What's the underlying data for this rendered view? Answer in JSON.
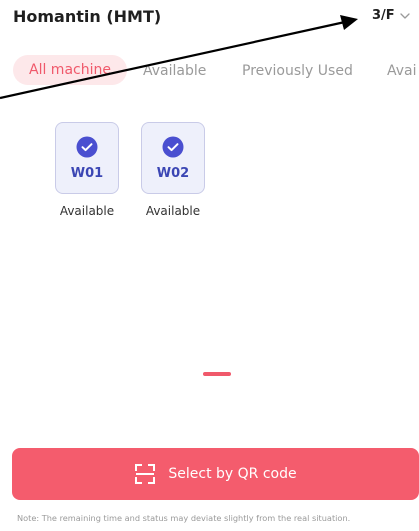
{
  "header": {
    "location": "Homantin (HMT)",
    "floor": "3/F"
  },
  "tabs": [
    {
      "label": "All machine",
      "active": true
    },
    {
      "label": "Available",
      "active": false
    },
    {
      "label": "Previously Used",
      "active": false
    },
    {
      "label": "Avai",
      "active": false
    }
  ],
  "machines": [
    {
      "code": "W01",
      "status": "Available",
      "icon": "check-circle-icon"
    },
    {
      "code": "W02",
      "status": "Available",
      "icon": "check-circle-icon"
    }
  ],
  "qr_button": {
    "label": "Select by QR code",
    "icon": "qr-scan-icon"
  },
  "note": "Note: The remaining time and status may deviate slightly from the real situation.",
  "colors": {
    "accent": "#f45c6d",
    "tab_active_bg": "#fde8ea",
    "machine_bg": "#eef0fb",
    "machine_border": "#c9cbe8",
    "machine_code": "#3b46b4",
    "check": "#4a4fd0",
    "muted": "#9a9a9a"
  }
}
